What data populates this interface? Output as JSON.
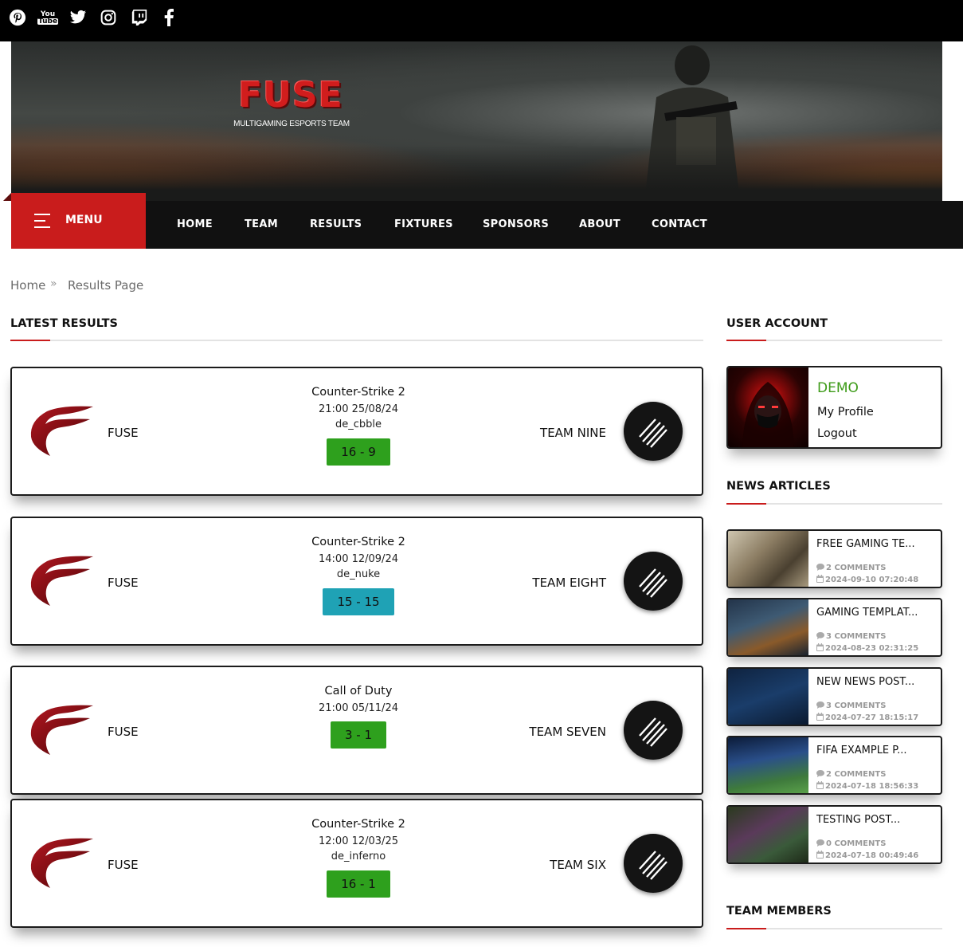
{
  "social": [
    "pinterest-icon",
    "youtube-icon",
    "twitter-icon",
    "instagram-icon",
    "twitch-icon",
    "facebook-icon"
  ],
  "youtube_label": [
    "You",
    "Tube"
  ],
  "banner": {
    "logo": "FUSE",
    "tagline": "MULTIGAMING ESPORTS TEAM"
  },
  "menu": {
    "label": "MENU"
  },
  "nav": [
    "HOME",
    "TEAM",
    "RESULTS",
    "FIXTURES",
    "SPONSORS",
    "ABOUT",
    "CONTACT"
  ],
  "breadcrumb": {
    "home": "Home",
    "current": "Results Page"
  },
  "latest_results_title": "LATEST RESULTS",
  "results": [
    {
      "home": "FUSE",
      "game": "Counter-Strike 2",
      "datetime": "21:00 25/08/24",
      "map": "de_cbble",
      "score": "16 - 9",
      "away": "TEAM NINE",
      "color": "#2ea01d"
    },
    {
      "home": "FUSE",
      "game": "Counter-Strike 2",
      "datetime": "14:00 12/09/24",
      "map": "de_nuke",
      "score": "15 - 15",
      "away": "TEAM EIGHT",
      "color": "#1fa2b5"
    },
    {
      "home": "FUSE",
      "game": "Call of Duty",
      "datetime": "21:00 05/11/24",
      "map": "",
      "score": "3 - 1",
      "away": "TEAM SEVEN",
      "color": "#2ea01d"
    },
    {
      "home": "FUSE",
      "game": "Counter-Strike 2",
      "datetime": "12:00 12/03/25",
      "map": "de_inferno",
      "score": "16 - 1",
      "away": "TEAM SIX",
      "color": "#2ea01d"
    }
  ],
  "user_account": {
    "title": "USER ACCOUNT",
    "username": "DEMO",
    "profile": "My Profile",
    "logout": "Logout"
  },
  "news_articles_title": "NEWS ARTICLES",
  "news": [
    {
      "title": "FREE GAMING TE...",
      "comments": "2 COMMENTS",
      "date": "2024-09-10 07:20:48"
    },
    {
      "title": "GAMING TEMPLAT...",
      "comments": "3 COMMENTS",
      "date": "2024-08-23 02:31:25"
    },
    {
      "title": "NEW NEWS POST...",
      "comments": "3 COMMENTS",
      "date": "2024-07-27 18:15:17"
    },
    {
      "title": "FIFA EXAMPLE P...",
      "comments": "2 COMMENTS",
      "date": "2024-07-18 18:56:33"
    },
    {
      "title": "TESTING POST...",
      "comments": "0 COMMENTS",
      "date": "2024-07-18 00:49:46"
    }
  ],
  "team_members_title": "TEAM MEMBERS",
  "colors": {
    "accent": "#c91c1c",
    "win": "#2ea01d",
    "draw": "#1fa2b5",
    "username": "#3d9b18"
  }
}
